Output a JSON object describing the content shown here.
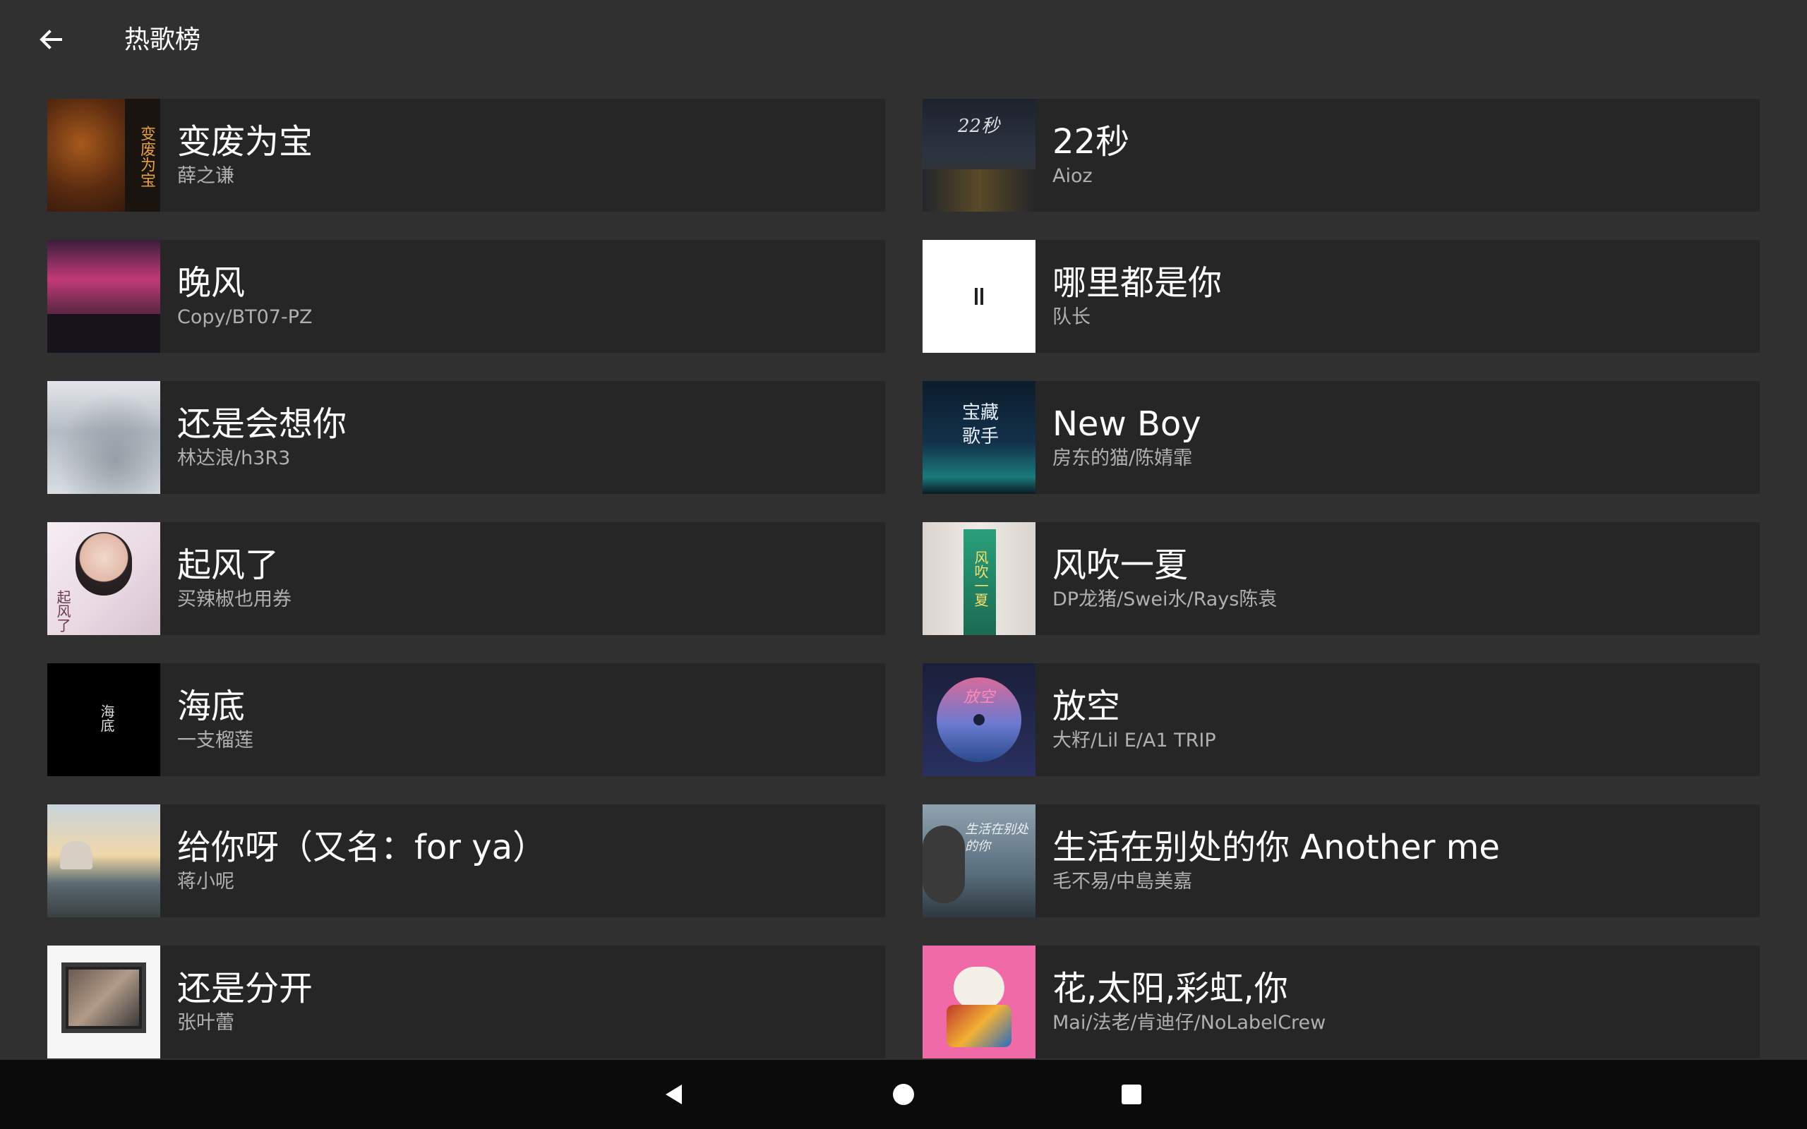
{
  "header": {
    "title": "热歌榜",
    "back_icon": "arrow-left-icon"
  },
  "songs": [
    {
      "title": "变废为宝",
      "artist": "薛之谦",
      "cover_text": "变废为宝",
      "accent": "#6b3a1a"
    },
    {
      "title": "22秒",
      "artist": "Aioz",
      "cover_text": "22秒",
      "accent": "#2c3340"
    },
    {
      "title": "晚风",
      "artist": "Copy/BT07-PZ",
      "cover_text": "",
      "accent": "#b03a6a"
    },
    {
      "title": "哪里都是你",
      "artist": "队长",
      "cover_text": "",
      "accent": "#ffffff"
    },
    {
      "title": "还是会想你",
      "artist": "林达浪/h3R3",
      "cover_text": "",
      "accent": "#c7ccd3"
    },
    {
      "title": "New Boy",
      "artist": "房东的猫/陈婧霏",
      "cover_text": "宝藏歌手",
      "accent": "#10304a"
    },
    {
      "title": "起风了",
      "artist": "买辣椒也用券",
      "cover_text": "起风了",
      "accent": "#e9dce6"
    },
    {
      "title": "风吹一夏",
      "artist": "DP龙猪/Swei水/Rays陈袁",
      "cover_text": "风吹一夏",
      "accent": "#2a8a6a"
    },
    {
      "title": "海底",
      "artist": "一支榴莲",
      "cover_text": "海底",
      "accent": "#000000"
    },
    {
      "title": "放空",
      "artist": "大籽/Lil E/A1 TRIP",
      "cover_text": "放空",
      "accent": "#4a5aa0"
    },
    {
      "title": "给你呀（又名：for ya）",
      "artist": "蒋小呢",
      "cover_text": "",
      "accent": "#8aa0b8"
    },
    {
      "title": "生活在别处的你 Another me",
      "artist": "毛不易/中島美嘉",
      "cover_text": "生活在别处的你",
      "accent": "#5a7080"
    },
    {
      "title": "还是分开",
      "artist": "张叶蕾",
      "cover_text": "",
      "accent": "#f4f4f4"
    },
    {
      "title": "花,太阳,彩虹,你",
      "artist": "Mai/法老/肯迪仔/NoLabelCrew",
      "cover_text": "",
      "accent": "#f06aa8"
    }
  ],
  "navbar": {
    "back_icon": "triangle-back-icon",
    "home_icon": "circle-home-icon",
    "recents_icon": "square-recents-icon"
  }
}
